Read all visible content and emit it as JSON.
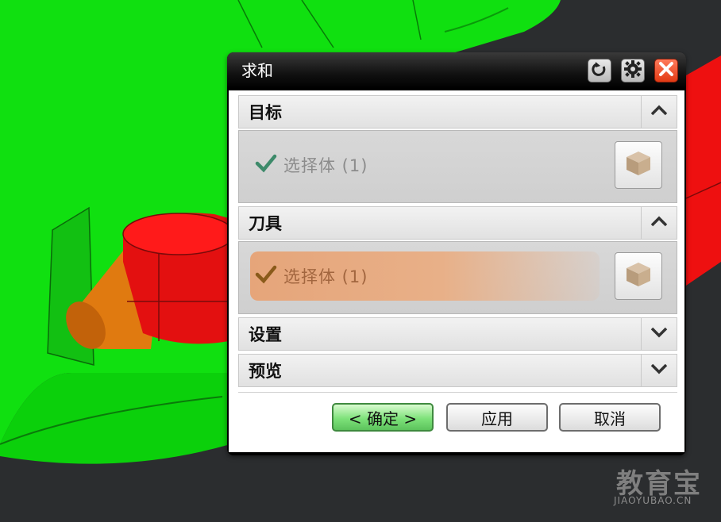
{
  "dialog": {
    "title": "求和",
    "titlebar_buttons": [
      {
        "name": "reset",
        "icon": "reset-icon"
      },
      {
        "name": "settings",
        "icon": "gear-icon"
      },
      {
        "name": "close",
        "icon": "close-icon"
      }
    ],
    "sections": [
      {
        "label": "目标",
        "expanded": true,
        "select_label": "选择体 (1)",
        "selected": true,
        "active": false,
        "icon": "solid-body-icon"
      },
      {
        "label": "刀具",
        "expanded": true,
        "select_label": "选择体 (1)",
        "selected": true,
        "active": true,
        "icon": "solid-body-icon"
      },
      {
        "label": "设置",
        "expanded": false
      },
      {
        "label": "预览",
        "expanded": false
      }
    ],
    "buttons": {
      "ok": "< 确定 >",
      "apply": "应用",
      "cancel": "取消"
    }
  },
  "colors": {
    "model_green": "#10e010",
    "model_red": "#ee1010",
    "model_orange": "#e07a10",
    "background": "#2b2d2f",
    "active_row": "#e6a57a",
    "ok_button": "#7ee27a"
  },
  "watermark": {
    "logo_text": "教育宝",
    "url": "JIAOYUBAO.CN"
  }
}
